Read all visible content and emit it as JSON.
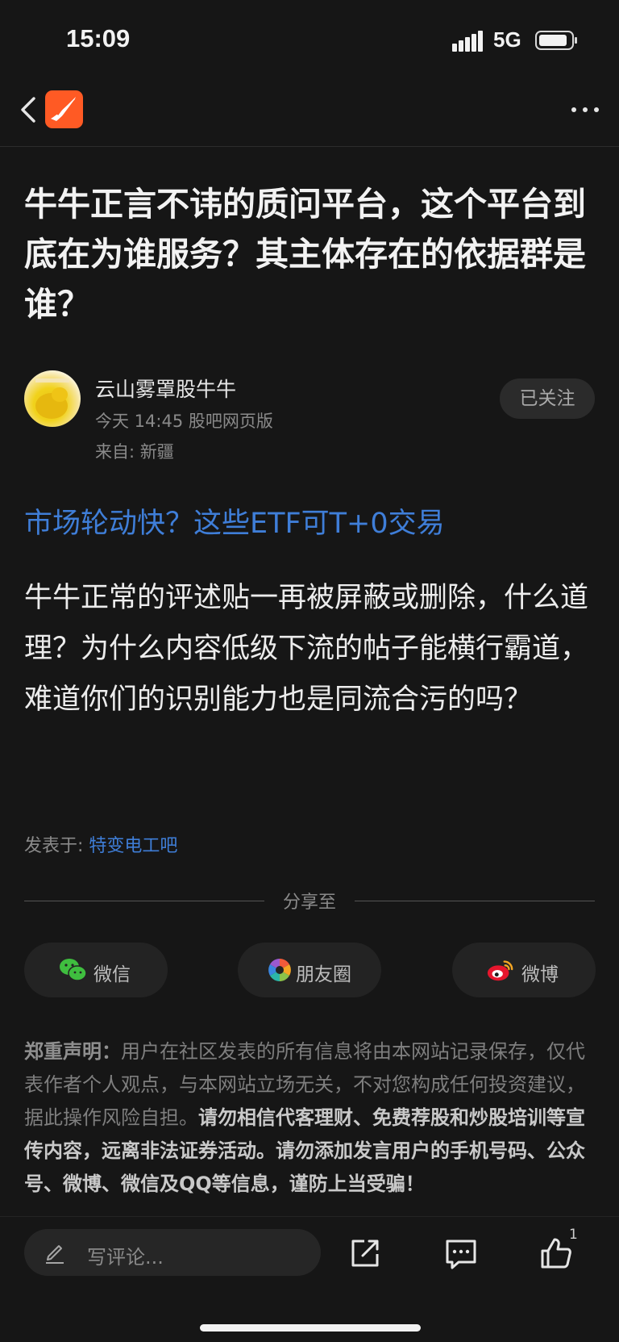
{
  "status_bar": {
    "time": "15:09",
    "network": "5G"
  },
  "post": {
    "title": "牛牛正言不讳的质问平台，这个平台到底在为谁服务？其主体存在的依据群是谁？",
    "author": {
      "name": "云山雾罩股牛牛",
      "meta": "今天 14:45 股吧网页版",
      "location": "来自: 新疆",
      "follow_label": "已关注"
    },
    "ad_link": "市场轮动快？这些ETF可T+0交易",
    "body": "牛牛正常的评述贴一再被屏蔽或删除，什么道理？为什么内容低级下流的帖子能横行霸道，难道你们的识别能力也是同流合污的吗？",
    "posted_in_label": "发表于: ",
    "forum": "特变电工吧"
  },
  "share": {
    "label": "分享至",
    "buttons": [
      {
        "label": "微信",
        "icon": "wechat-icon"
      },
      {
        "label": "朋友圈",
        "icon": "moments-icon"
      },
      {
        "label": "微博",
        "icon": "weibo-icon"
      }
    ]
  },
  "disclaimer": {
    "heading": "郑重声明：",
    "text": "用户在社区发表的所有信息将由本网站记录保存，仅代表作者个人观点，与本网站立场无关，不对您构成任何投资建议，据此操作风险自担。",
    "warning": "请勿相信代客理财、免费荐股和炒股培训等宣传内容，远离非法证券活动。请勿添加发言用户的手机号码、公众号、微博、微信及QQ等信息，谨防上当受骗！"
  },
  "bottom_bar": {
    "comment_placeholder": "写评论...",
    "like_count": "1"
  },
  "colors": {
    "accent_blue": "#3f7ed8",
    "logo_orange": "#ff5a24",
    "background": "#161616"
  }
}
